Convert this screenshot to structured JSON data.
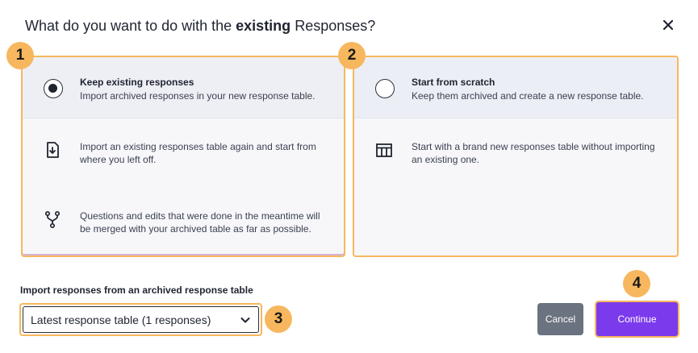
{
  "dialog": {
    "title_prefix": "What do you want to do with the ",
    "title_bold": "existing",
    "title_suffix": " Responses?",
    "close_icon": "close-icon"
  },
  "options": {
    "keep": {
      "title": "Keep existing responses",
      "subtitle": "Import archived responses in your new response table.",
      "selected": true,
      "features": [
        {
          "icon": "download-file-icon",
          "text": "Import an existing responses table again and start from where you left off."
        },
        {
          "icon": "merge-icon",
          "text": "Questions and edits that were done in the meantime will be merged with your archived table as far as possible."
        }
      ]
    },
    "scratch": {
      "title": "Start from scratch",
      "subtitle": "Keep them archived and create a new response table.",
      "selected": false,
      "features": [
        {
          "icon": "table-icon",
          "text": "Start with a brand new responses table without importing an existing one."
        }
      ]
    }
  },
  "import": {
    "label": "Import responses from an archived response table",
    "selected_value": "Latest response table (1 responses)"
  },
  "buttons": {
    "cancel": "Cancel",
    "continue": "Continue"
  },
  "badges": [
    "1",
    "2",
    "3",
    "4"
  ],
  "colors": {
    "accent_highlight": "#f7b75e",
    "primary": "#7c3aed",
    "secondary": "#6b7280"
  }
}
